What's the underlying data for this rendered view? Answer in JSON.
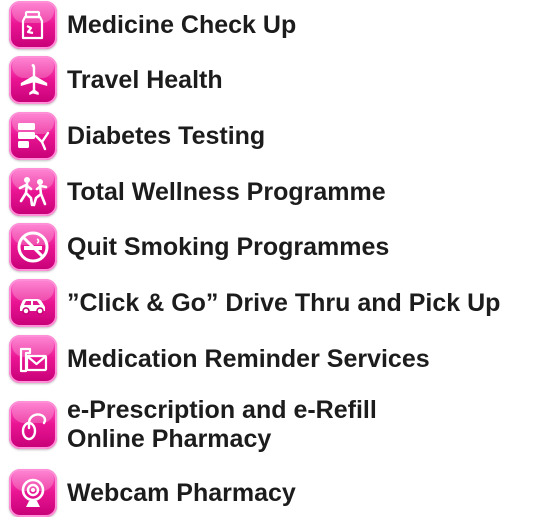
{
  "services": [
    {
      "label": "Medicine Check Up",
      "icon": "medicine-bottle-icon"
    },
    {
      "label": "Travel Health",
      "icon": "airplane-icon"
    },
    {
      "label": "Diabetes Testing",
      "icon": "glucose-meter-icon"
    },
    {
      "label": "Total Wellness Programme",
      "icon": "running-people-icon"
    },
    {
      "label": "Quit Smoking Programmes",
      "icon": "no-smoking-icon"
    },
    {
      "label": "”Click & Go” Drive Thru and Pick Up",
      "icon": "car-icon"
    },
    {
      "label": "Medication Reminder Services",
      "icon": "mail-reminder-icon"
    },
    {
      "label_line1": "e-Prescription and e-Refill",
      "label_line2": "Online Pharmacy",
      "icon": "computer-mouse-icon"
    },
    {
      "label": "Webcam Pharmacy",
      "icon": "webcam-icon"
    }
  ],
  "colors": {
    "icon_gradient_top": "#ff66c8",
    "icon_gradient_bottom": "#c60077",
    "text": "#1c1c1c"
  }
}
